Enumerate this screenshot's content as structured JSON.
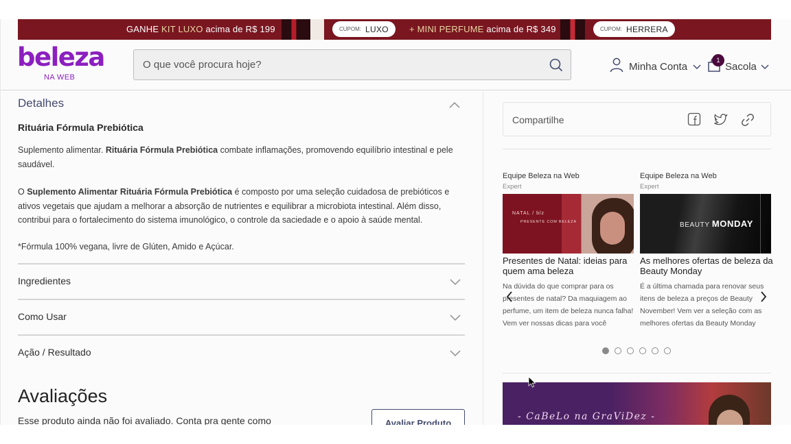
{
  "promo": {
    "msg1_prefix": "GANHE ",
    "msg1_highlight": "KIT LUXO",
    "msg1_suffix": " acima de R$ 199",
    "coupon1_key": "CUPOM:",
    "coupon1_value": "LUXO",
    "msg2_prefix": "+ MINI PERFUME",
    "msg2_suffix": " acima de R$ 349",
    "coupon2_key": "CUPOM:",
    "coupon2_value": "HERRERA"
  },
  "header": {
    "logo": "beleza",
    "logo_sub": "NA WEB",
    "search_placeholder": "O que você procura hoje?",
    "account_label": "Minha Conta",
    "bag_label": "Sacola",
    "bag_count": "1"
  },
  "details": {
    "title": "Detalhes",
    "product_name": "Rituária Fórmula Prebiótica",
    "p1_a": "Suplemento alimentar. ",
    "p1_b": "Rituária Fórmula Prebiótica",
    "p1_c": " combate inflamações, promovendo equilíbrio intestinal e pele saudável.",
    "p2_a": "O ",
    "p2_b": "Suplemento Alimentar Rituária Fórmula Prebiótica",
    "p2_c": " é composto por uma seleção cuidadosa de prebióticos e ativos vegetais que ajudam a melhorar a absorção de nutrientes e equilibrar a microbiota intestinal. Além disso, contribui para o fortalecimento do sistema imunológico, o controle da saciedade e o apoio à saúde mental.",
    "p3": "*Fórmula 100% vegana, livre de Glúten, Amido e Açúcar."
  },
  "accordions": [
    {
      "label": "Ingredientes"
    },
    {
      "label": "Como Usar"
    },
    {
      "label": "Ação / Resultado"
    }
  ],
  "reviews": {
    "title": "Avaliações",
    "text": "Esse produto ainda não foi avaliado. Conta pra gente como",
    "button": "Avaliar Produto"
  },
  "share": {
    "label": "Compartilhe"
  },
  "cards": [
    {
      "author": "Equipe Beleza na Web",
      "role": "Expert",
      "img_text1": "NATAL / blz",
      "img_text2": "PRESENTE COM BELEZA",
      "title": "Presentes de Natal: ideias para quem ama beleza",
      "text": "Na dúvida do que comprar para os presentes de natal? Da maquiagem ao perfume, um item de beleza nunca falha! Vem ver nossas dicas para você"
    },
    {
      "author": "Equipe Beleza na Web",
      "role": "Expert",
      "img_text1": "BEAUTY ",
      "img_text2": "MONDAY",
      "title": "As melhores ofertas de beleza da Beauty Monday",
      "text": "É a última chamada para renovar seus itens de beleza a preços de Beauty November! Vem ver a seleção com as melhores ofertas da Beauty Monday"
    }
  ],
  "carousel": {
    "active_index": 0,
    "count": 6
  },
  "banner2": {
    "text": "- CaBeLo na GraViDez -"
  },
  "colors": {
    "brand": "#8c1fbf",
    "promo_bg": "#7a1620",
    "accent_text": "#444a6e"
  }
}
